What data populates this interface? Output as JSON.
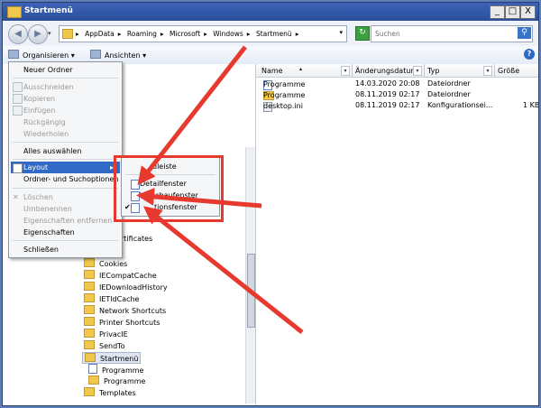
{
  "window": {
    "title": "Startmenü",
    "controls": {
      "minimize": "_",
      "maximize": "□",
      "close": "X"
    }
  },
  "address": {
    "crumbs": [
      "AppData",
      "Roaming",
      "Microsoft",
      "Windows",
      "Startmenü"
    ],
    "separator": "▸",
    "refresh_icon": "↻"
  },
  "search": {
    "placeholder": "Suchen",
    "icon": "search-icon",
    "glyph": "⚲"
  },
  "toolbar": {
    "organize": "Organisieren",
    "views": "Ansichten",
    "dropdown": "▾",
    "help": "?"
  },
  "columns": {
    "name": "Name",
    "modified": "Änderungsdatum",
    "type": "Typ",
    "size": "Größe",
    "sort_arrow": "▴",
    "dropdown": "▾"
  },
  "files": [
    {
      "name": "Programme",
      "date": "14.03.2020 20:08",
      "type": "Dateiordner",
      "size": ""
    },
    {
      "name": "Programme",
      "date": "08.11.2019 02:17",
      "type": "Dateiordner",
      "size": ""
    },
    {
      "name": "desktop.ini",
      "date": "08.11.2019 02:17",
      "type": "Konfigurationsei...",
      "size": "1 KB"
    }
  ],
  "tree": {
    "partial": "rtificates",
    "items": [
      {
        "label": "Cookies",
        "icon": "folder"
      },
      {
        "label": "IECompatCache",
        "icon": "folder"
      },
      {
        "label": "IEDownloadHistory",
        "icon": "folder"
      },
      {
        "label": "IETldCache",
        "icon": "folder"
      },
      {
        "label": "Network Shortcuts",
        "icon": "folder"
      },
      {
        "label": "Printer Shortcuts",
        "icon": "folder"
      },
      {
        "label": "PrivacIE",
        "icon": "folder"
      },
      {
        "label": "SendTo",
        "icon": "folder"
      },
      {
        "label": "Startmenü",
        "icon": "folder",
        "selected": true
      },
      {
        "label": "Programme",
        "icon": "programs"
      },
      {
        "label": "Programme",
        "icon": "folder"
      },
      {
        "label": "Templates",
        "icon": "folder"
      }
    ]
  },
  "menu": {
    "new_folder": "Neuer Ordner",
    "cut": "Ausschneiden",
    "copy": "Kopieren",
    "paste": "Einfügen",
    "undo": "Rückgängig",
    "redo": "Wiederholen",
    "select_all": "Alles auswählen",
    "layout": "Layout",
    "folder_options": "Ordner- und Suchoptionen",
    "delete": "Löschen",
    "rename": "Umbenennen",
    "remove_properties": "Eigenschaften entfernen",
    "properties": "Eigenschaften",
    "close": "Schließen",
    "submenu_arrow": "▸"
  },
  "submenu": {
    "menubar": "üleiste",
    "details": "Detailfenster",
    "preview": "Vorschaufenster",
    "navigation": "tionsfenster",
    "checkmark": "✔"
  },
  "colors": {
    "annotation": "#e8392e",
    "highlight": "#3169c6"
  }
}
